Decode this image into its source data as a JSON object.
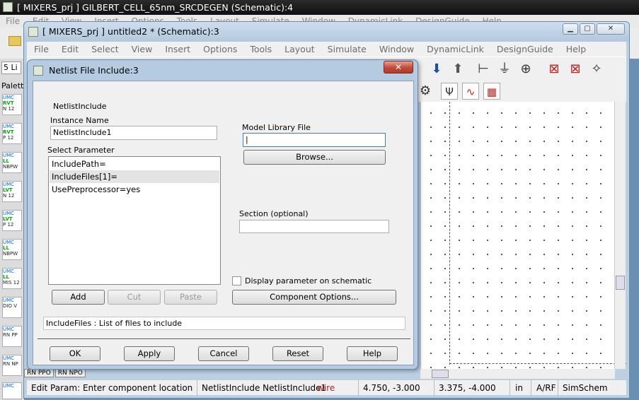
{
  "outer_window": {
    "title": "[ MIXERS_prj ] GILBERT_CELL_65nm_SRCDEGEN (Schematic):4",
    "menu": [
      "File",
      "Edit",
      "View",
      "Insert",
      "Options",
      "Tools",
      "Layout",
      "Simulate",
      "Window",
      "DynamicLink",
      "DesignGuide",
      "Help"
    ],
    "combo_value": "5 Li",
    "palette_label": "Palett",
    "components": [
      {
        "brand": "UMC",
        "tag": "RVT",
        "label": "N 12"
      },
      {
        "brand": "UMC",
        "tag": "RVT",
        "label": "P 12"
      },
      {
        "brand": "UMC",
        "tag": "LL",
        "label": "NBPW"
      },
      {
        "brand": "UMC",
        "tag": "LVT",
        "label": "N 12"
      },
      {
        "brand": "UMC",
        "tag": "LVT",
        "label": "P 12"
      },
      {
        "brand": "UMC",
        "tag": "LL",
        "label": "NBPW"
      },
      {
        "brand": "UMC",
        "tag": "LL",
        "label": "MIS 12"
      },
      {
        "brand": "UMC",
        "tag": "",
        "label": "DIO V"
      },
      {
        "brand": "UMC",
        "tag": "",
        "label": "RN PP"
      },
      {
        "brand": "UMC",
        "tag": "",
        "label": "RN NP"
      },
      {
        "brand": "UMC",
        "tag": "",
        "label": ""
      }
    ]
  },
  "inner_window": {
    "title": "[ MIXERS_prj ] untitled2 * (Schematic):3",
    "menu": [
      "File",
      "Edit",
      "Select",
      "View",
      "Insert",
      "Options",
      "Tools",
      "Layout",
      "Simulate",
      "Window",
      "DynamicLink",
      "DesignGuide",
      "Help"
    ],
    "bottom_tabs": [
      "RN PPO",
      "RN NPO"
    ],
    "status": {
      "message": "Edit Param: Enter component location",
      "component": "NetlistInclude NetlistInclude1",
      "layer": "wire",
      "coord1": "4.750, -3.000",
      "coord2": "3.375, -4.000",
      "units": "in",
      "mode": "A/RF",
      "view": "SimSchem"
    }
  },
  "dialog": {
    "title": "Netlist File Include:3",
    "close_label": "✕",
    "component_name": "NetlistInclude",
    "instance_name_label": "Instance Name",
    "instance_name_value": "NetlistInclude1",
    "select_parameter_label": "Select Parameter",
    "parameters": [
      "IncludePath=",
      "IncludeFiles[1]=",
      "UsePreprocessor=yes"
    ],
    "selected_parameter_index": 1,
    "model_library_label": "Model Library File",
    "model_library_value": "",
    "browse_label": "Browse...",
    "section_label": "Section (optional)",
    "section_value": "",
    "display_param_label": "Display parameter on schematic",
    "display_param_checked": false,
    "add_label": "Add",
    "cut_label": "Cut",
    "paste_label": "Paste",
    "component_options_label": "Component Options...",
    "help_text": "IncludeFiles : List of files to include",
    "ok_label": "OK",
    "apply_label": "Apply",
    "cancel_label": "Cancel",
    "reset_label": "Reset",
    "help_label": "Help"
  }
}
